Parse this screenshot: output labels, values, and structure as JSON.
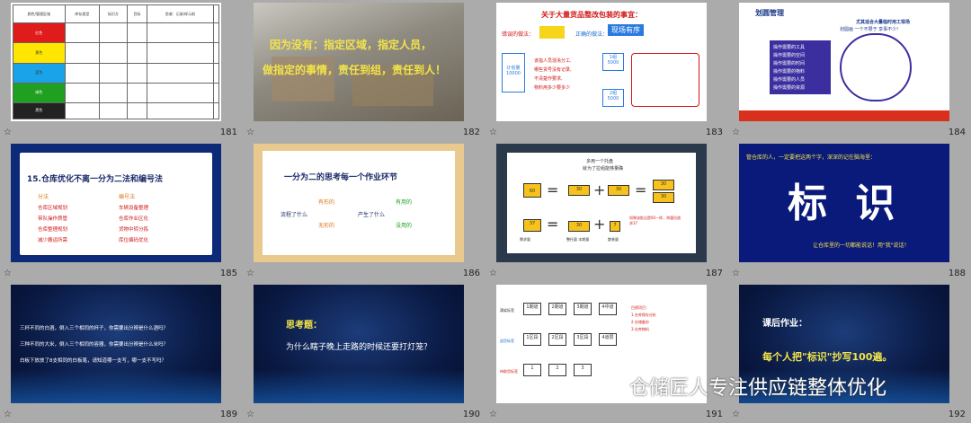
{
  "slides": [
    {
      "num": "181",
      "rows": [
        {
          "c1": "红色",
          "color": "#e01b1b"
        },
        {
          "c1": "黄色",
          "color": "#ffe600"
        },
        {
          "c1": "蓝色",
          "color": "#1aa3e8"
        },
        {
          "c1": "绿色",
          "color": "#20a020"
        },
        {
          "c1": "黑色",
          "color": "#222222"
        }
      ],
      "h": [
        "颜色/管理区域",
        "库存类型",
        "标识方",
        "目标",
        "验收：记录/样示前"
      ]
    },
    {
      "num": "182",
      "line1": "因为没有：指定区域，指定人员，",
      "line2": "做指定的事情，责任到组，责任到人！"
    },
    {
      "num": "183",
      "title": "关于大量货品整改包装的事宜：",
      "wrong": "错误的做法：",
      "right": "正确的做法：",
      "stamp": "现场有序",
      "plan": "计划量",
      "qty": "10000",
      "lines": [
        "该指人员混淆分工,",
        "哪些货号没有记录,",
        "不清楚作要求,",
        "物料用多少要多少"
      ],
      "b1": "1组",
      "b1n": "5000",
      "b2": "2组",
      "b2n": "5000"
    },
    {
      "num": "184",
      "title": "划圆管理",
      "subtitle": "尤其适合大量临时用工现场",
      "items": [
        "操作需要的工具",
        "操作需要的空间",
        "操作需要的时间",
        "操作需要的物料",
        "操作需要的人员",
        "操作需要的资源"
      ],
      "ring": "划圆画 一个不限于 享事不少!"
    },
    {
      "num": "185",
      "title": "15.仓库优化不离一分为二法和编号法",
      "col1": "分法",
      "col2": "编号法",
      "left": [
        "仓库区域规划",
        "带队操作质管",
        "仓库整理规划",
        "减少搬运所需"
      ],
      "right": [
        "车辆设备整理",
        "仓库作业区化",
        "货物中转分拣",
        "库位编码优化"
      ]
    },
    {
      "num": "186",
      "title": "一分为二的思考每一个作业环节",
      "q1": "流程了什么",
      "a1": "有形的",
      "a2": "无形的",
      "q2": "产生了什么",
      "b1": "有用的",
      "b2": "没用的"
    },
    {
      "num": "187",
      "top": "多用一个托盘",
      "top2": "就为了拉组能够量确",
      "n60": "60",
      "n30": "30",
      "n37": "37",
      "n7": "7",
      "lab1": "需求量",
      "lab2": "整托量 本期量",
      "lab3": "散装量",
      "note": "如果该批出是60一样，则量拉放求37"
    },
    {
      "num": "188",
      "intro": "管仓库的人，一定要把这两个字，深深的记在脑海里：",
      "big": "标 识",
      "tag": "让仓库里的一切都能说话！用\"我\"说话！"
    },
    {
      "num": "189",
      "l1": "三杯不同的白酒，倒入三个相同的杯子，你需要出分辨是什么酒吗？",
      "l2": "三种不同的大米，倒入三个相同的容器，你需要出分辨是什么米吗？",
      "l3": "白板下放放了8支相同的白板笔，请知道哪一支写，哪一支不写吗？"
    },
    {
      "num": "190",
      "title": "思考题：",
      "q": "为什么瞎子晚上走路的时候还要打灯笼？"
    },
    {
      "num": "191",
      "r1": "满架标签",
      "r2": "退货标签",
      "r3": "待取货标签",
      "box": [
        "1期道",
        "2期道",
        "3期道",
        "4中道"
      ],
      "box2": [
        "1区段",
        "2区段",
        "3区段",
        "4道层"
      ],
      "box3": [
        "1",
        "2",
        "3"
      ],
      "side": [
        "目视项目：",
        "1.仓库保存分析",
        "2.仓储备份",
        "3.仓库物料"
      ]
    },
    {
      "num": "192",
      "title": "课后作业：",
      "body": "每个人把\"标识\"抄写100遍。"
    }
  ],
  "star": "☆",
  "watermark": "仓储匠人专注供应链整体优化",
  "accent": "#f2e34a"
}
